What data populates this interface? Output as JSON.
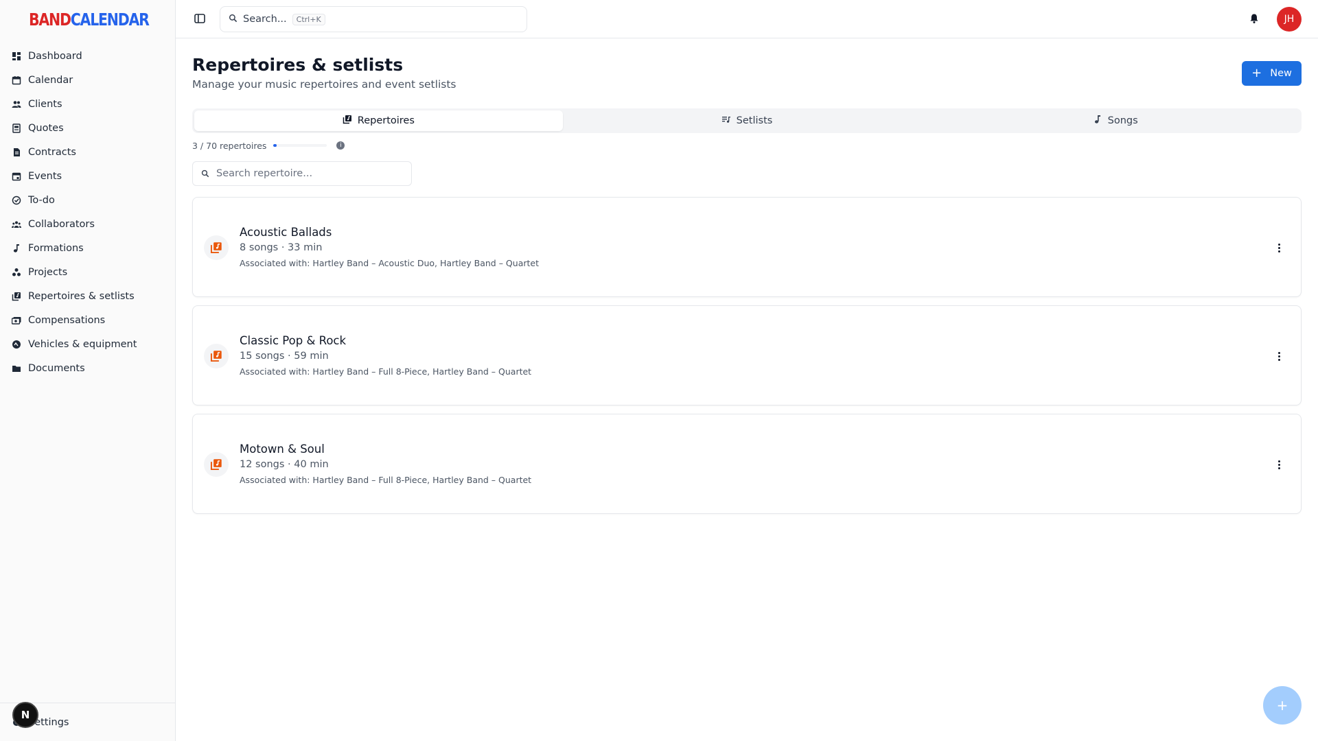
{
  "app": {
    "brand_part1": "BAND",
    "brand_part2": "CALENDAR"
  },
  "sidebar": {
    "items": [
      {
        "label": "Dashboard",
        "icon": "dashboard-icon"
      },
      {
        "label": "Calendar",
        "icon": "calendar-icon"
      },
      {
        "label": "Clients",
        "icon": "clients-icon"
      },
      {
        "label": "Quotes",
        "icon": "quotes-icon"
      },
      {
        "label": "Contracts",
        "icon": "contracts-icon"
      },
      {
        "label": "Events",
        "icon": "events-icon"
      },
      {
        "label": "To-do",
        "icon": "todo-icon"
      },
      {
        "label": "Collaborators",
        "icon": "collaborators-icon"
      },
      {
        "label": "Formations",
        "icon": "music-note-icon"
      },
      {
        "label": "Projects",
        "icon": "projects-icon"
      },
      {
        "label": "Repertoires & setlists",
        "icon": "repertoire-icon"
      },
      {
        "label": "Compensations",
        "icon": "compensations-icon"
      },
      {
        "label": "Vehicles & equipment",
        "icon": "vehicles-icon"
      },
      {
        "label": "Documents",
        "icon": "folder-icon"
      }
    ],
    "settings_label": "Settings",
    "badge_letter": "N"
  },
  "topbar": {
    "search_label": "Search...",
    "search_shortcut": "Ctrl+K",
    "avatar_initials": "JH"
  },
  "page": {
    "title": "Repertoires & setlists",
    "subtitle": "Manage your music repertoires and event setlists",
    "new_button": "New"
  },
  "tabs": [
    {
      "label": "Repertoires",
      "active": true
    },
    {
      "label": "Setlists",
      "active": false
    },
    {
      "label": "Songs",
      "active": false
    }
  ],
  "usage": {
    "text": "3 / 70 repertoires",
    "used": 3,
    "limit": 70
  },
  "repertoire_search": {
    "placeholder": "Search repertoire..."
  },
  "repertoires": [
    {
      "title": "Acoustic Ballads",
      "meta": "8 songs · 33 min",
      "associated": "Associated with: Hartley Band – Acoustic Duo, Hartley Band – Quartet"
    },
    {
      "title": "Classic Pop & Rock",
      "meta": "15 songs · 59 min",
      "associated": "Associated with: Hartley Band – Full 8-Piece, Hartley Band – Quartet"
    },
    {
      "title": "Motown & Soul",
      "meta": "12 songs · 40 min",
      "associated": "Associated with: Hartley Band – Full 8-Piece, Hartley Band – Quartet"
    }
  ],
  "fab_label": "+",
  "colors": {
    "brand_red": "#dc2626",
    "brand_blue": "#2563eb",
    "primary_button": "#1d6fe0",
    "repertoire_icon": "#ea580c"
  }
}
